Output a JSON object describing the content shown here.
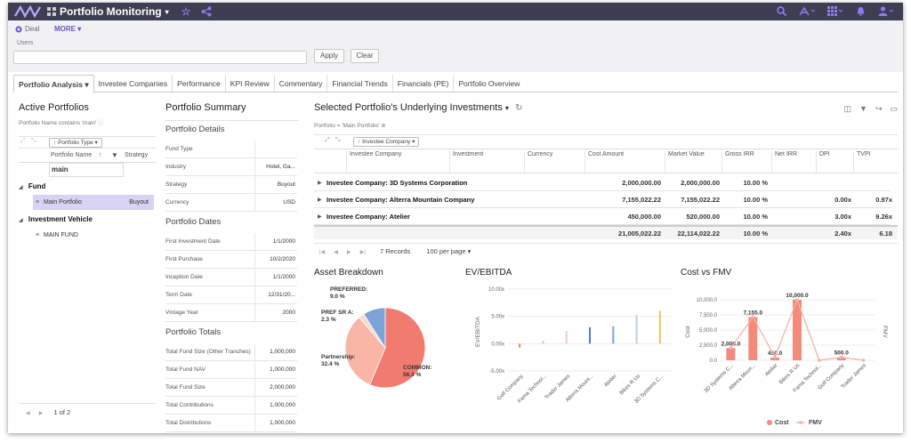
{
  "app": {
    "title": "Portfolio Monitoring"
  },
  "filter": {
    "deal_label": "Deal",
    "more_label": "MORE",
    "users_label": "Users",
    "users_value": "",
    "apply_label": "Apply",
    "clear_label": "Clear"
  },
  "tabs": [
    "Portfolio Analysis",
    "Investee Companies",
    "Performance",
    "KPI Review",
    "Commentary",
    "Financial Trends",
    "Financials (PE)",
    "Portfolio Overview"
  ],
  "active_portfolios": {
    "title": "Active Portfolios",
    "filter_text": "Portfolio Name contains 'main'",
    "group_chip": "Portfolio Type",
    "col_name": "Portfolio Name",
    "col_strategy": "Strategy",
    "filter_value": "main",
    "group_fund": "Fund",
    "item_main": "Main Portfolio",
    "item_main_strategy": "Buyout",
    "group_vehicle": "Investment Vehicle",
    "item_mainfund": "MAIN FUND",
    "pager": "1 of 2"
  },
  "summary": {
    "title": "Portfolio Summary",
    "details_title": "Portfolio Details",
    "details": [
      {
        "label": "Fund Type",
        "value": ""
      },
      {
        "label": "Industry",
        "value": "Hotel, Ga..."
      },
      {
        "label": "Strategy",
        "value": "Buyout"
      },
      {
        "label": "Currency",
        "value": "USD"
      }
    ],
    "dates_title": "Portfolio Dates",
    "dates": [
      {
        "label": "First Investment Date",
        "value": "1/1/2000"
      },
      {
        "label": "First Purchase",
        "value": "10/2/2020"
      },
      {
        "label": "Inception Date",
        "value": "1/1/2000"
      },
      {
        "label": "Term Date",
        "value": "12/31/20..."
      },
      {
        "label": "Vintage Year",
        "value": "2000"
      }
    ],
    "totals_title": "Portfolio Totals",
    "totals": [
      {
        "label": "Total Fund Size (Other Tranches)",
        "value": "1,000,000"
      },
      {
        "label": "Total Fund NAV",
        "value": "1,000,000"
      },
      {
        "label": "Total Fund Size",
        "value": "2,000,000"
      },
      {
        "label": "Total Contributions",
        "value": "1,000,000"
      },
      {
        "label": "Total Distributions",
        "value": "1,000,000"
      }
    ]
  },
  "investments": {
    "title": "Selected Portfolio's Underlying Investments",
    "filter_text": "Portfolio = 'Main Portfolio'",
    "group_chip": "Investee Company",
    "columns": [
      "Investee Company",
      "Investment",
      "Currency",
      "Cost Amount",
      "Market Value",
      "Gross IRR",
      "Net IRR",
      "DPI",
      "TVPI"
    ],
    "rows": [
      {
        "name": "Investee Company: 3D Systems Corporation",
        "cost": "2,000,000.00",
        "market": "2,000,000.00",
        "gross": "10.00 %",
        "dpi": "",
        "tvpi": ""
      },
      {
        "name": "Investee Company: Alterra Mountain Company",
        "cost": "7,155,022.22",
        "market": "7,155,022.22",
        "gross": "10.00 %",
        "dpi": "0.00x",
        "tvpi": "0.97x"
      },
      {
        "name": "Investee Company: Atelier",
        "cost": "450,000.00",
        "market": "520,000.00",
        "gross": "10.00 %",
        "dpi": "3.00x",
        "tvpi": "9.26x"
      }
    ],
    "total": {
      "cost": "21,005,022.22",
      "market": "22,114,022.22",
      "gross": "10.00 %",
      "dpi": "2.40x",
      "tvpi": "6.18"
    },
    "records": "7 Records",
    "per_page": "100 per page"
  },
  "chart_data": [
    {
      "type": "pie",
      "title": "Asset Breakdown",
      "slices": [
        {
          "label": "COMMON:",
          "pct_text": "56.3 %",
          "value": 56.3,
          "color": "#f07b6e"
        },
        {
          "label": "Partnership:",
          "pct_text": "32.4 %",
          "value": 32.4,
          "color": "#f9b5a6"
        },
        {
          "label": "PREF SR A:",
          "pct_text": "2.3 %",
          "value": 2.3,
          "color": "#fbd9cf"
        },
        {
          "label": "PREFERRED:",
          "pct_text": "9.0 %",
          "value": 9.0,
          "color": "#7ea3d9"
        }
      ]
    },
    {
      "type": "bar",
      "title": "EV/EBITDA",
      "ylabel": "EV/EBITDA",
      "ylim": [
        -3,
        10
      ],
      "yticks": [
        "10.00x",
        "5.00x",
        "0.00x",
        "-5.00x"
      ],
      "ytick_values": [
        10,
        5,
        0,
        -5
      ],
      "categories": [
        "Golf Company",
        "Fama Technol...",
        "Trader James",
        "Alterra Mount...",
        "Atelier",
        "Bikes R Us",
        "3D Systems C..."
      ],
      "values": [
        -0.7,
        0.5,
        2.3,
        3.0,
        3.2,
        5.3,
        6.0
      ],
      "colors": [
        "#f07b6e",
        "#f9b5a6",
        "#f3c9b7",
        "#4f7fd0",
        "#7ea3d9",
        "#b9cdea",
        "#f2c14e"
      ]
    },
    {
      "type": "bar",
      "title": "Cost vs FMV",
      "ylabel": "Cost",
      "y2label": "FMV",
      "ylim": [
        0,
        10000
      ],
      "yticks": [
        "10,000.0",
        "7,500.0",
        "5,000.0",
        "2,500.0",
        "0.0"
      ],
      "ytick_values": [
        10000,
        7500,
        5000,
        2500,
        0
      ],
      "categories": [
        "3D Systems C...",
        "Alterra Moun...",
        "Atelier",
        "Bikes R Us",
        "Fama Technol...",
        "Golf Company",
        "Trader James"
      ],
      "series": [
        {
          "name": "Cost",
          "values": [
            2000,
            7155,
            450,
            10000,
            0,
            500,
            0
          ],
          "labels": [
            "2,000.0",
            "7,155.0",
            "450.0",
            "10,000.0",
            "",
            "500.0",
            ""
          ],
          "color": "#f38b7c"
        },
        {
          "name": "FMV",
          "values": [
            2000,
            7155,
            520,
            10000,
            0,
            500,
            0
          ],
          "color": "#f9b2a4"
        }
      ]
    }
  ]
}
